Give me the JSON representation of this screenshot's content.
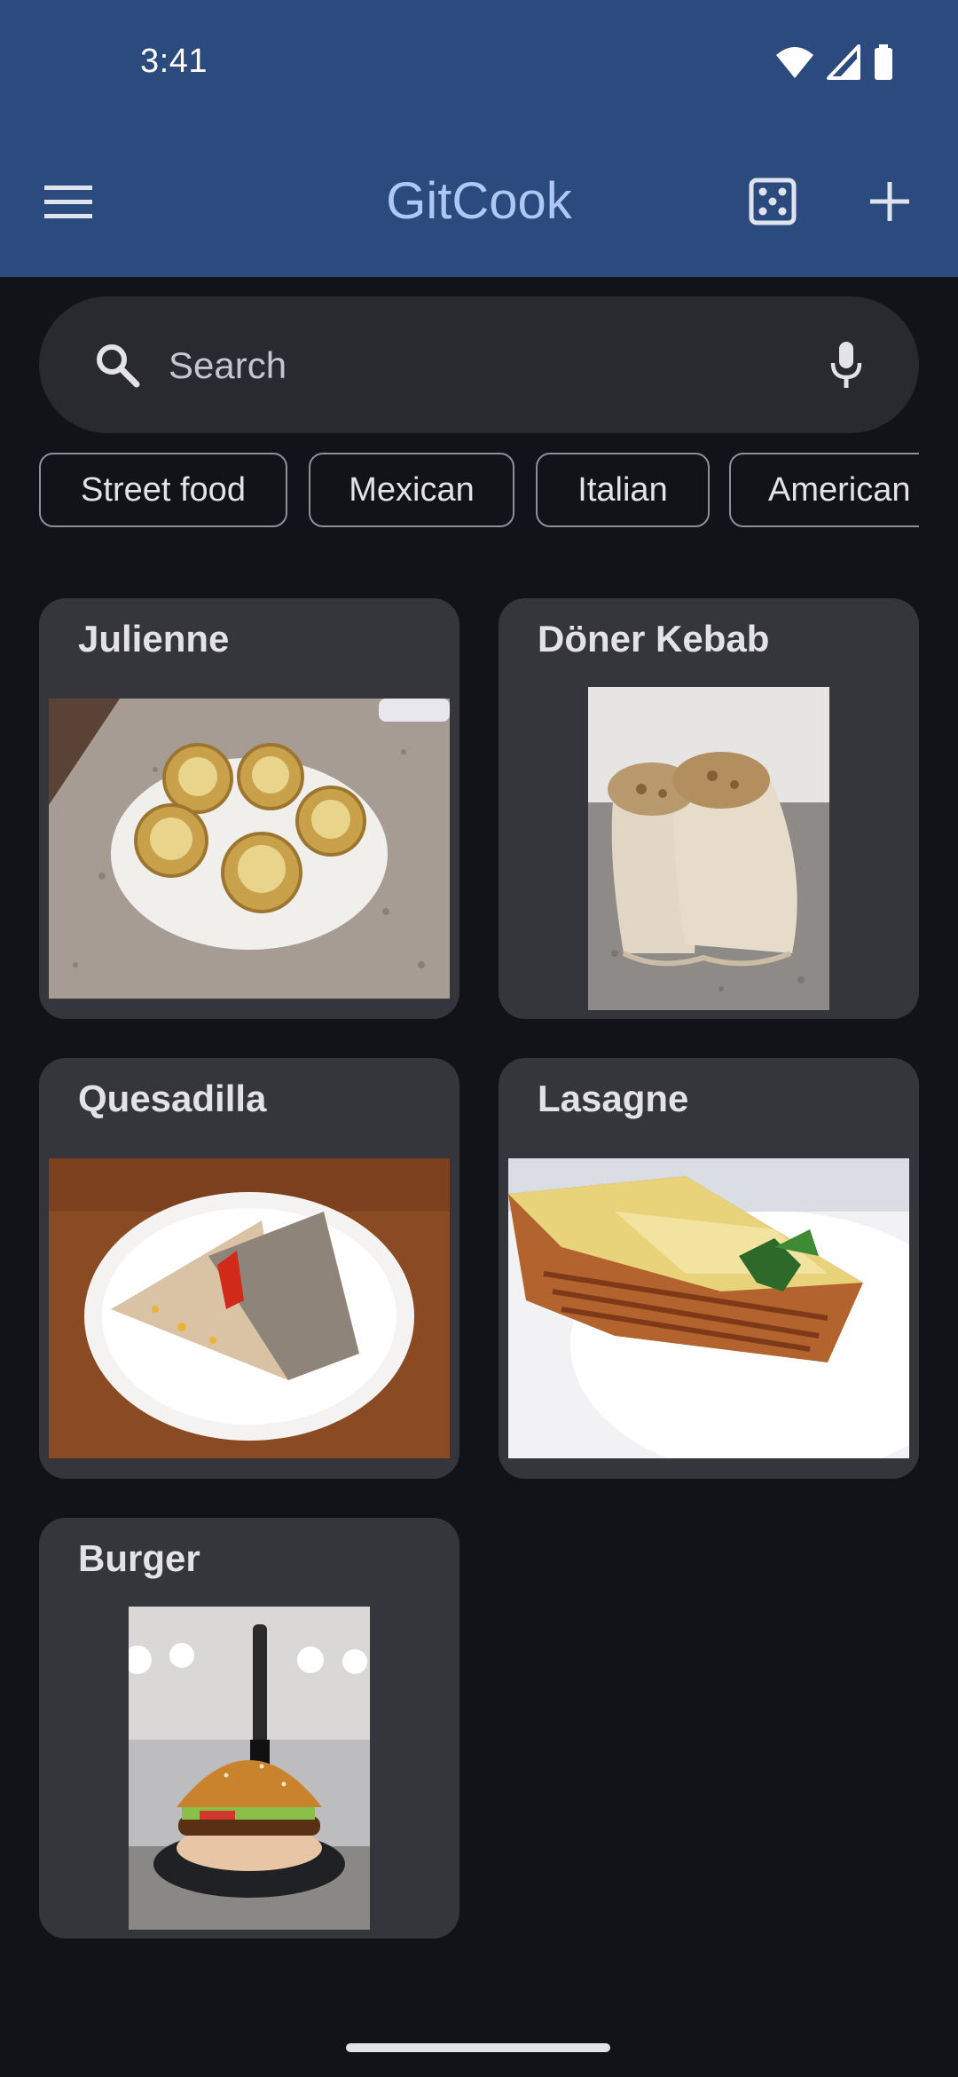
{
  "status_bar": {
    "time": "3:41",
    "icons": [
      "wifi-icon",
      "cellular-signal-icon",
      "battery-icon"
    ]
  },
  "app_bar": {
    "menu_icon": "menu-icon",
    "title": "GitCook",
    "random_icon": "dice-icon",
    "add_icon": "plus-icon"
  },
  "search": {
    "placeholder": "Search",
    "value": "",
    "leading_icon": "search-icon",
    "trailing_icon": "microphone-icon"
  },
  "filters": [
    {
      "label": "Street food"
    },
    {
      "label": "Mexican"
    },
    {
      "label": "Italian"
    },
    {
      "label": "American"
    }
  ],
  "recipes": [
    {
      "title": "Julienne",
      "image": "tartlets with melted cheese on a white plate"
    },
    {
      "title": "Döner Kebab",
      "image": "two grilled wraps on a granite counter"
    },
    {
      "title": "Quesadilla",
      "image": "folded quesadilla on a white plate"
    },
    {
      "title": "Lasagne",
      "image": "lasagne slice with parsley on a white plate"
    },
    {
      "title": "Burger",
      "image": "burger with a knife stuck through it"
    }
  ],
  "colors": {
    "app_bar_background": "#2b4a7e",
    "title_text": "#aec8f5",
    "background": "#121318",
    "card_background": "#35363b",
    "search_background": "#292a30"
  }
}
